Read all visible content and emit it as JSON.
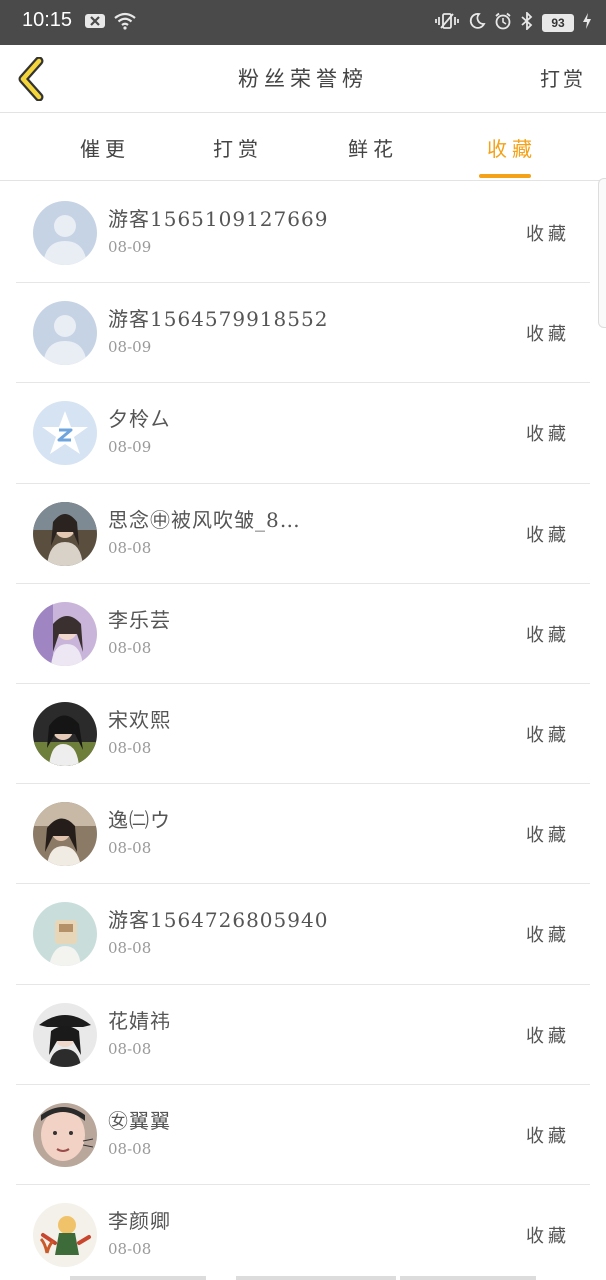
{
  "status_bar": {
    "time": "10:15",
    "battery": "93"
  },
  "header": {
    "title": "粉丝荣誉榜",
    "action_label": "打赏"
  },
  "tabs": [
    {
      "label": "催更",
      "active": false
    },
    {
      "label": "打赏",
      "active": false
    },
    {
      "label": "鲜花",
      "active": false
    },
    {
      "label": "收藏",
      "active": true
    }
  ],
  "colors": {
    "accent": "#f4a218",
    "status_bar": "#4a4a4a"
  },
  "fans": [
    {
      "name": "游客15651091​27669",
      "date": "08-09",
      "action": "收藏",
      "avatar": "default-user-icon"
    },
    {
      "name": "游客15645799​18552",
      "date": "08-09",
      "action": "收藏",
      "avatar": "default-user-icon"
    },
    {
      "name": "夕柃ㄙ",
      "date": "08-09",
      "action": "收藏",
      "avatar": "qzone-star-icon"
    },
    {
      "name": "思念㊥被风吹皱_8…",
      "date": "08-08",
      "action": "收藏",
      "avatar": "photo"
    },
    {
      "name": "李乐芸",
      "date": "08-08",
      "action": "收藏",
      "avatar": "photo"
    },
    {
      "name": "宋欢熙",
      "date": "08-08",
      "action": "收藏",
      "avatar": "photo"
    },
    {
      "name": "逸㈡ウ",
      "date": "08-08",
      "action": "收藏",
      "avatar": "photo"
    },
    {
      "name": "游客15647268​05940",
      "date": "08-08",
      "action": "收藏",
      "avatar": "photo"
    },
    {
      "name": "花婧祎",
      "date": "08-08",
      "action": "收藏",
      "avatar": "photo"
    },
    {
      "name": "㊛翼翼",
      "date": "08-08",
      "action": "收藏",
      "avatar": "photo"
    },
    {
      "name": "李颜卿",
      "date": "08-08",
      "action": "收藏",
      "avatar": "photo"
    }
  ]
}
